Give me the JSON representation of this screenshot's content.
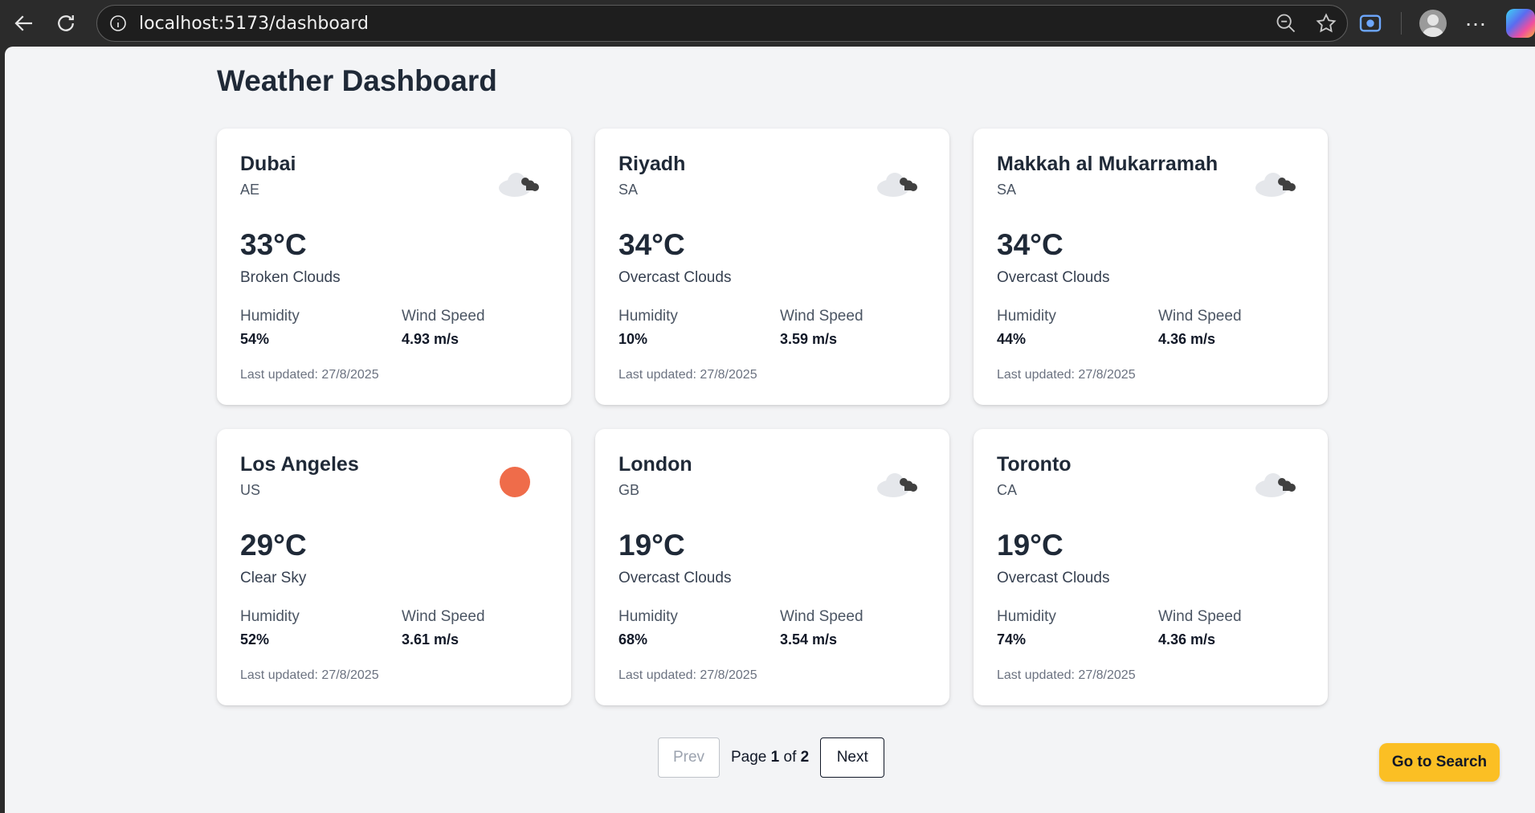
{
  "browser": {
    "url": "localhost:5173/dashboard"
  },
  "page": {
    "title": "Weather Dashboard"
  },
  "labels": {
    "humidity": "Humidity",
    "wind_speed": "Wind Speed",
    "last_updated_prefix": "Last updated: "
  },
  "cards": [
    {
      "city": "Dubai",
      "country": "AE",
      "temp": "33°C",
      "desc": "Broken Clouds",
      "humidity": "54%",
      "wind": "4.93 m/s",
      "updated": "Last updated: 27/8/2025",
      "icon": "cloud-icon"
    },
    {
      "city": "Riyadh",
      "country": "SA",
      "temp": "34°C",
      "desc": "Overcast Clouds",
      "humidity": "10%",
      "wind": "3.59 m/s",
      "updated": "Last updated: 27/8/2025",
      "icon": "cloud-icon"
    },
    {
      "city": "Makkah al Mukarramah",
      "country": "SA",
      "temp": "34°C",
      "desc": "Overcast Clouds",
      "humidity": "44%",
      "wind": "4.36 m/s",
      "updated": "Last updated: 27/8/2025",
      "icon": "cloud-icon"
    },
    {
      "city": "Los Angeles",
      "country": "US",
      "temp": "29°C",
      "desc": "Clear Sky",
      "humidity": "52%",
      "wind": "3.61 m/s",
      "updated": "Last updated: 27/8/2025",
      "icon": "sun-icon"
    },
    {
      "city": "London",
      "country": "GB",
      "temp": "19°C",
      "desc": "Overcast Clouds",
      "humidity": "68%",
      "wind": "3.54 m/s",
      "updated": "Last updated: 27/8/2025",
      "icon": "cloud-icon"
    },
    {
      "city": "Toronto",
      "country": "CA",
      "temp": "19°C",
      "desc": "Overcast Clouds",
      "humidity": "74%",
      "wind": "4.36 m/s",
      "updated": "Last updated: 27/8/2025",
      "icon": "cloud-icon"
    }
  ],
  "pagination": {
    "prev_label": "Prev",
    "page_word": "Page",
    "current": "1",
    "of_word": "of",
    "total": "2",
    "next_label": "Next"
  },
  "search_button": {
    "label": "Go to Search"
  },
  "colors": {
    "sun": "#ef6c4a",
    "cloud_light": "#e5e7eb",
    "cloud_dark": "#404040",
    "accent": "#fbbf24"
  }
}
